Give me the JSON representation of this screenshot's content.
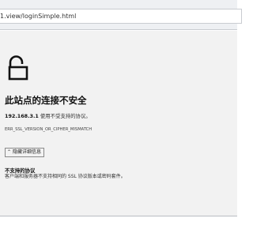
{
  "address_bar": {
    "url": "1.view/loginSimple.html"
  },
  "page": {
    "lock_icon": "lock-icon",
    "title": "此站点的连接不安全",
    "host": "192.168.3.1",
    "host_message": " 使用不受支持的协议。",
    "error_code": "ERR_SSL_VERSION_OR_CIPHER_MISMATCH",
    "details_button_label": "隐藏详细信息",
    "details_button_icon": "chevron-up-icon",
    "unsupported_title": "不支持的协议",
    "unsupported_description": "客户端和服务器不支持相同的 SSL 协议版本或密码套件。"
  }
}
